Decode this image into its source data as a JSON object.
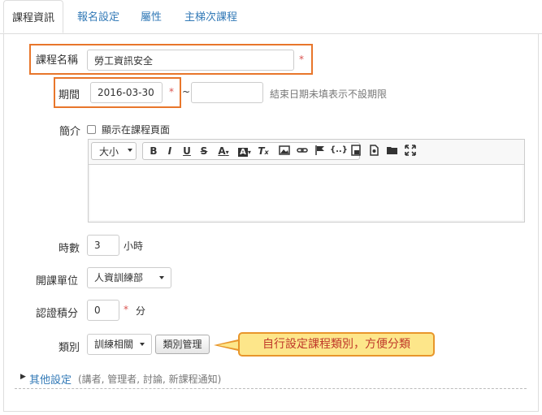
{
  "tabs": [
    {
      "label": "課程資訊",
      "active": true
    },
    {
      "label": "報名設定",
      "active": false
    },
    {
      "label": "屬性",
      "active": false
    },
    {
      "label": "主梯次課程",
      "active": false
    }
  ],
  "form": {
    "course_name": {
      "label": "課程名稱",
      "value": "勞工資訊安全",
      "required": "*"
    },
    "period": {
      "label": "期間",
      "start_value": "2016-03-30",
      "required": "*",
      "separator": "~",
      "end_value": "",
      "hint": "結束日期未填表示不設期限"
    },
    "intro": {
      "label": "簡介",
      "checkbox_label": "顯示在課程頁面",
      "checked": false
    },
    "hours": {
      "label": "時數",
      "value": "3",
      "unit": "小時"
    },
    "unit": {
      "label": "開課單位",
      "selected": "人資訓練部"
    },
    "credits": {
      "label": "認證積分",
      "value": "0",
      "required": "*",
      "unit": "分"
    },
    "category": {
      "label": "類別",
      "selected": "訓練相關",
      "manage_button": "類別管理"
    },
    "other": {
      "label": "其他設定",
      "hint": "(講者, 管理者, 討論, 新課程通知)"
    }
  },
  "editor": {
    "font_size_label": "大小"
  },
  "callout": {
    "text": "自行設定課程類別，方便分類"
  },
  "colors": {
    "accent": "#e8762b",
    "link": "#337ab7",
    "required": "#d9534f",
    "callout_bg": "#fde68a"
  }
}
